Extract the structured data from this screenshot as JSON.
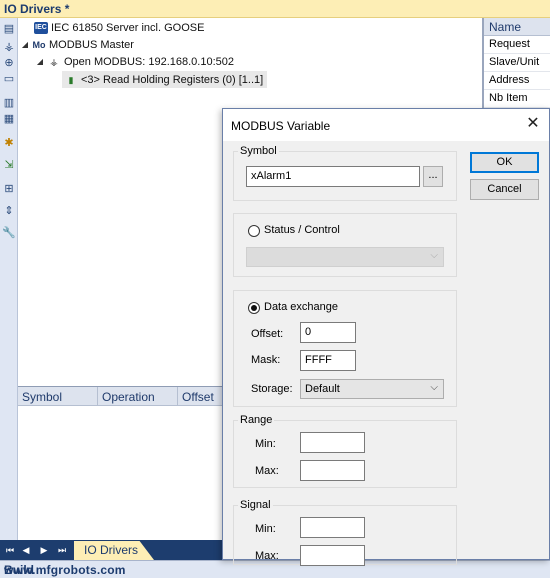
{
  "window": {
    "title": "IO Drivers *"
  },
  "tree": {
    "items": [
      {
        "label": "IEC 61850 Server incl. GOOSE",
        "icon": "iec-icon"
      },
      {
        "label": "MODBUS Master",
        "icon": "modbus-master-icon"
      },
      {
        "label": "Open MODBUS: 192.168.0.10:502",
        "icon": "network-icon"
      },
      {
        "label": "<3> Read Holding Registers (0) [1..1]",
        "icon": "register-icon"
      }
    ]
  },
  "properties": {
    "header": "Name",
    "rows": [
      "Request",
      "Slave/Unit",
      "Address",
      "Nb Item"
    ]
  },
  "grid": {
    "columns": [
      "Symbol",
      "Operation",
      "Offset"
    ]
  },
  "tabs": {
    "active": "IO Drivers"
  },
  "status": {
    "label": "Build"
  },
  "watermark": "www.mfgrobots.com",
  "dialog": {
    "title": "MODBUS Variable",
    "symbol_group": "Symbol",
    "symbol_value": "xAlarm1",
    "browse_label": "...",
    "ok_label": "OK",
    "cancel_label": "Cancel",
    "status_control_label": "Status / Control",
    "status_control_value": "",
    "data_exchange_label": "Data exchange",
    "offset_label": "Offset:",
    "offset_value": "0",
    "mask_label": "Mask:",
    "mask_value": "FFFF",
    "storage_label": "Storage:",
    "storage_value": "Default",
    "range_group": "Range",
    "range_min_label": "Min:",
    "range_max_label": "Max:",
    "range_min_value": "",
    "range_max_value": "",
    "signal_group": "Signal",
    "signal_min_label": "Min:",
    "signal_max_label": "Max:",
    "signal_min_value": "",
    "signal_max_value": ""
  },
  "colors": {
    "title_bg": "#fdeeb5",
    "tab_bar": "#1d3d6e",
    "accent": "#0078d7"
  }
}
